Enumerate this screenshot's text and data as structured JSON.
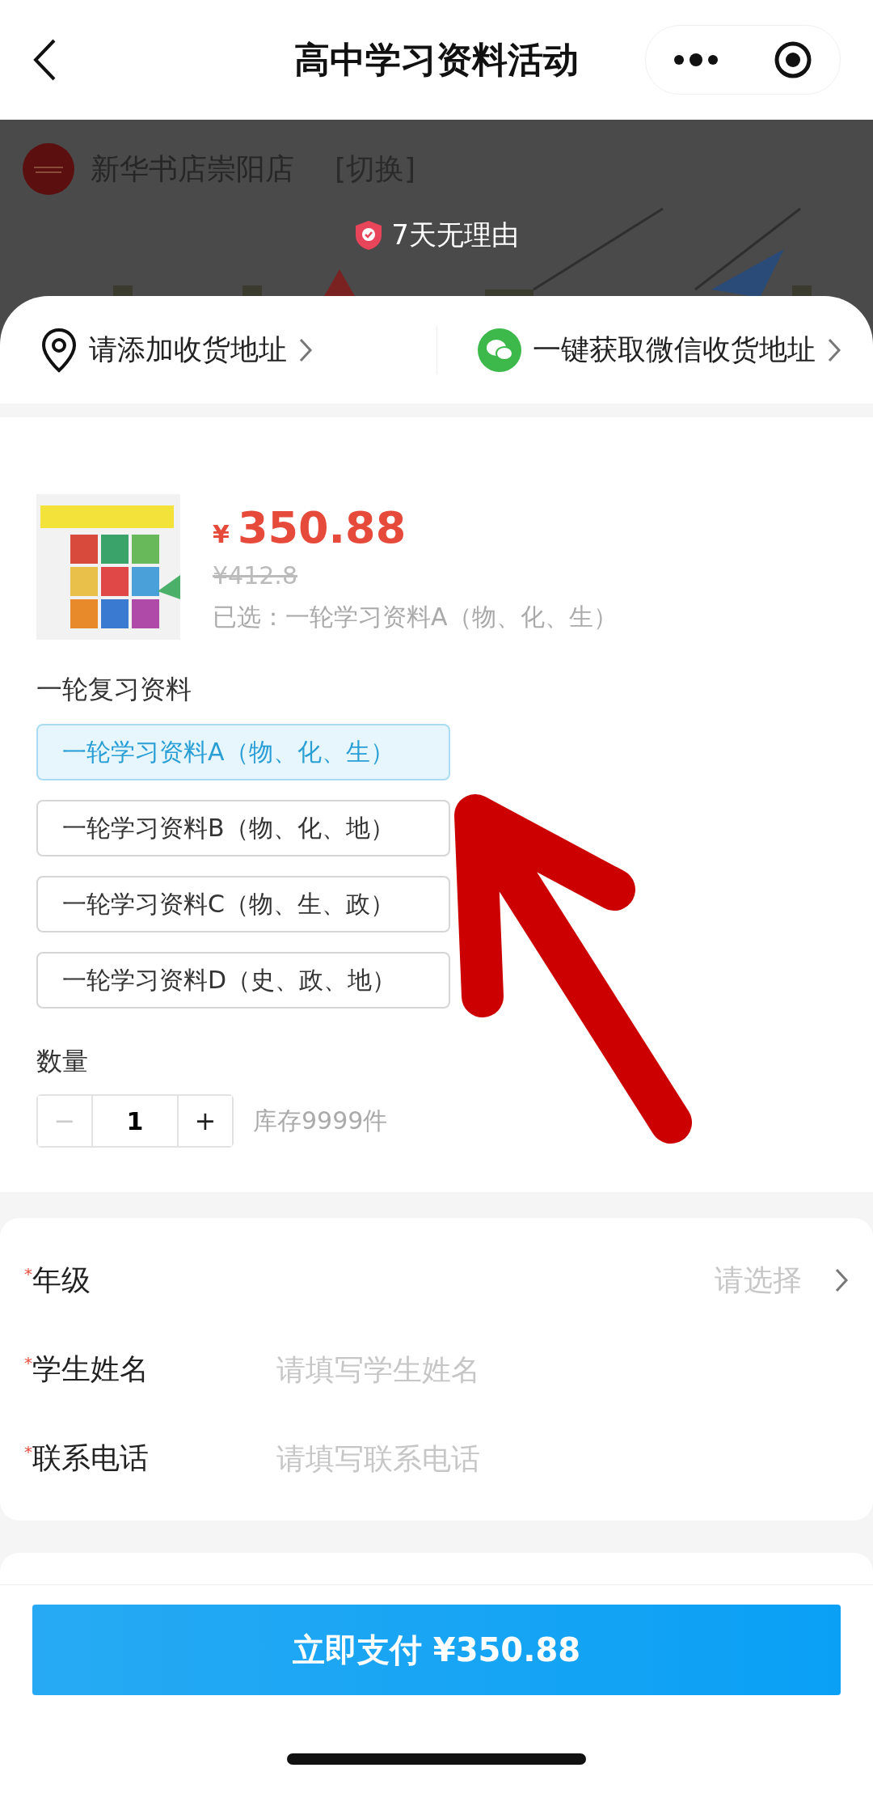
{
  "nav": {
    "title": "高中学习资料活动"
  },
  "store": {
    "name": "新华书店崇阳店",
    "switch": "[切换]",
    "guarantee": "7天无理由"
  },
  "address": {
    "add": "请添加收货地址",
    "wechat": "一键获取微信收货地址"
  },
  "product": {
    "currency": "¥",
    "price": "350.88",
    "original_price": "¥412.8",
    "chosen": "已选：一轮学习资料A（物、化、生）"
  },
  "spec": {
    "title": "一轮复习资料",
    "options": [
      {
        "label": "一轮学习资料A（物、化、生）",
        "selected": true
      },
      {
        "label": "一轮学习资料B（物、化、地）",
        "selected": false
      },
      {
        "label": "一轮学习资料C（物、生、政）",
        "selected": false
      },
      {
        "label": "一轮学习资料D（史、政、地）",
        "selected": false
      }
    ]
  },
  "quantity": {
    "title": "数量",
    "minus": "−",
    "minus_disabled": true,
    "value": "1",
    "plus": "+",
    "stock": "库存9999件"
  },
  "form": [
    {
      "mark": "*",
      "label": "年级",
      "kind": "select",
      "placeholder": "请选择"
    },
    {
      "mark": "*",
      "label": "学生姓名",
      "kind": "input",
      "placeholder": "请填写学生姓名"
    },
    {
      "mark": "*",
      "label": "联系电话",
      "kind": "input",
      "placeholder": "请填写联系电话"
    }
  ],
  "pay_button": "立即支付 ¥350.88"
}
